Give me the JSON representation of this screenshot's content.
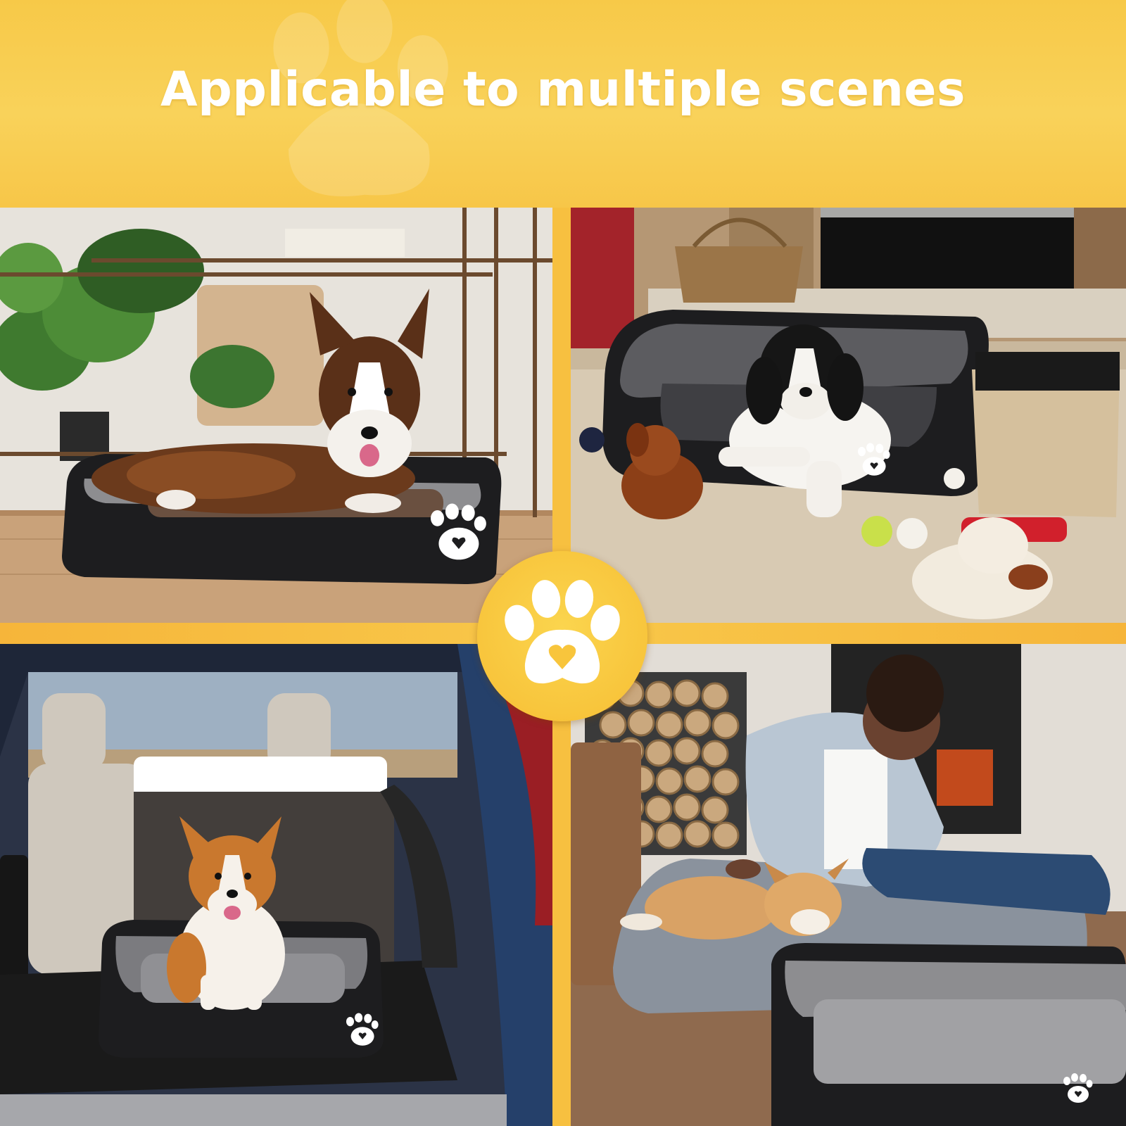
{
  "banner": {
    "headline": "Applicable to multiple scenes"
  },
  "colors": {
    "banner_yellow": "#f8cc4f",
    "divider_yellow": "#f7c040",
    "paw_white": "#ffffff",
    "bed_black": "#1d1d1f",
    "bed_plush_gray": "#8d8d90"
  },
  "scenes": [
    {
      "id": "living-room-shelf",
      "subject": "brindle corgi lying in pet bed"
    },
    {
      "id": "fireplace-toys",
      "subject": "spaniel puppy in pet bed with toys"
    },
    {
      "id": "car-trunk",
      "subject": "corgi sitting in pet bed in car trunk"
    },
    {
      "id": "living-room-rug",
      "subject": "child petting corgi puppy next to pet bed"
    }
  ],
  "icons": {
    "center_badge": "paw-heart-icon",
    "bed_logo": "paw-heart-icon"
  }
}
